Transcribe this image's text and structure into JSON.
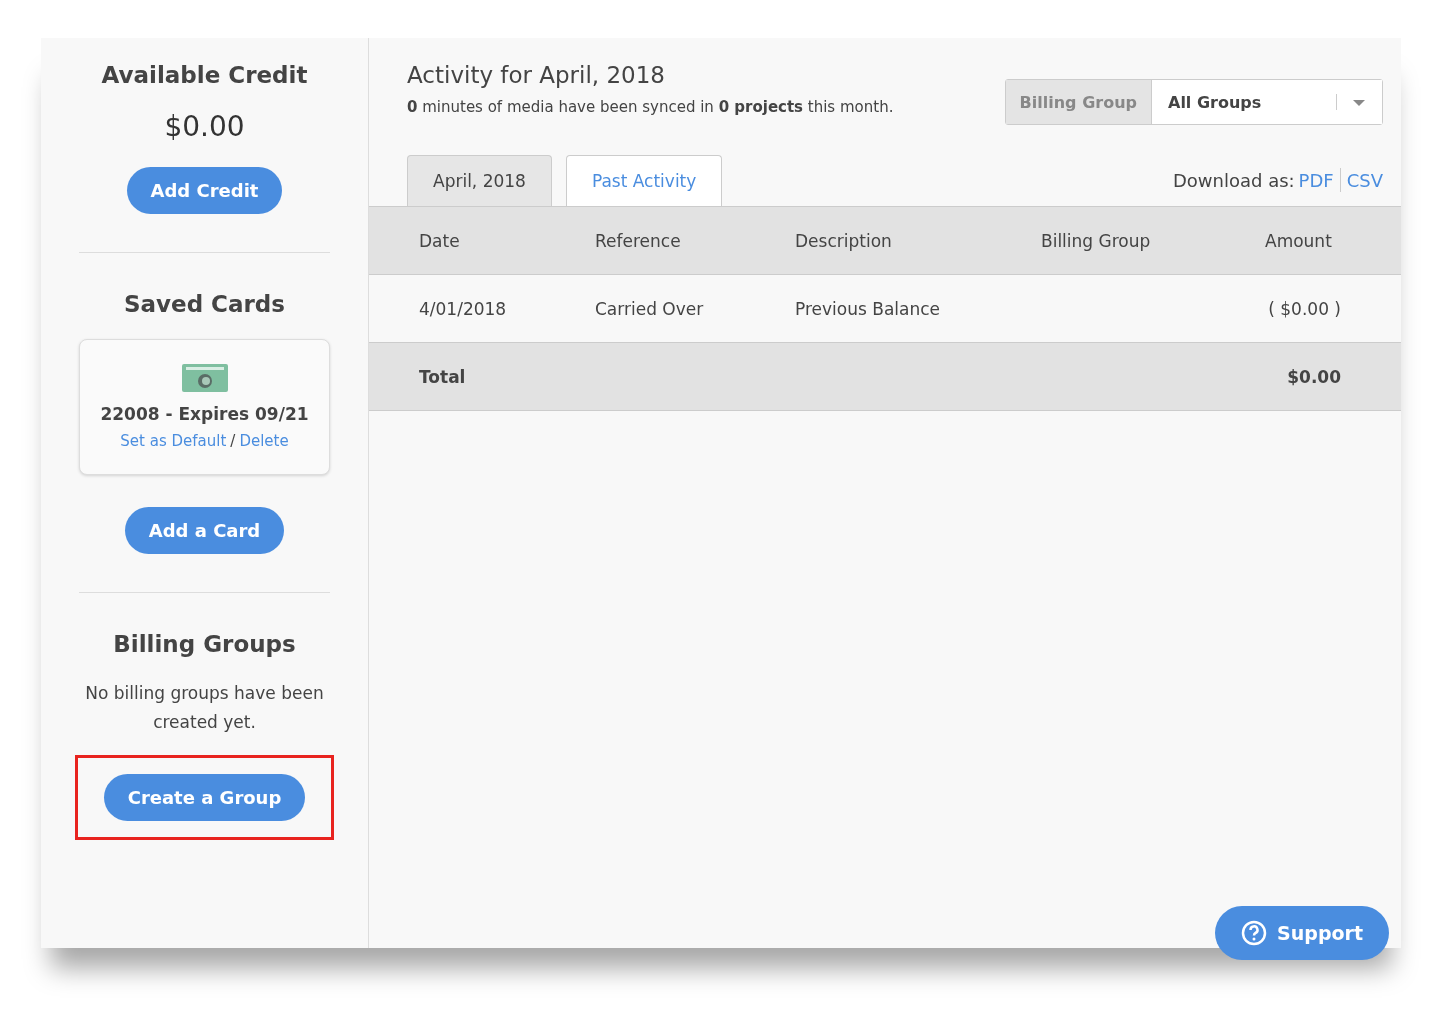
{
  "sidebar": {
    "credit": {
      "title": "Available Credit",
      "amount": "$0.00",
      "button": "Add Credit"
    },
    "cards": {
      "title": "Saved Cards",
      "items": [
        {
          "label": "22008 - Expires 09/21",
          "set_default": "Set as Default",
          "separator": "/",
          "delete": "Delete"
        }
      ],
      "button": "Add a Card"
    },
    "groups": {
      "title": "Billing Groups",
      "empty_text": "No billing groups have been created yet.",
      "button": "Create a Group",
      "highlighted": true
    }
  },
  "main": {
    "title": "Activity for April, 2018",
    "summary": "**0** minutes of media have been synced in **0 projects** this month.",
    "filter": {
      "label": "Billing Group",
      "value": "All Groups"
    },
    "tabs": [
      {
        "label": "April, 2018",
        "selected": true
      },
      {
        "label": "Past Activity",
        "selected": false
      }
    ],
    "download": {
      "label": "Download as:",
      "links": [
        "PDF",
        "CSV"
      ]
    },
    "table": {
      "columns": [
        "Date",
        "Reference",
        "Description",
        "Billing Group",
        "Amount"
      ],
      "rows": [
        [
          "4/01/2018",
          "Carried Over",
          "Previous Balance",
          "",
          "( $0.00 )"
        ]
      ],
      "total": {
        "label": "Total",
        "amount": "$0.00"
      }
    },
    "support": "Support"
  }
}
